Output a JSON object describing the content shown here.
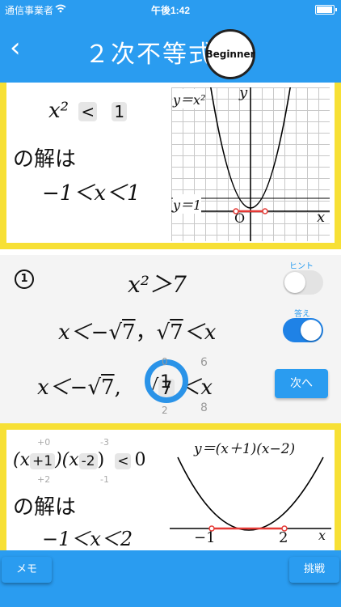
{
  "status_bar": {
    "carrier": "通信事業者",
    "time": "午後1:42"
  },
  "header": {
    "back_icon": "chevron-left-icon",
    "title": "２次不等式",
    "level_badge": "Beginner"
  },
  "example1": {
    "lhs": "x²",
    "op": "<",
    "rhs": "1",
    "solution_label": "の解は",
    "solution": "−1＜x＜1",
    "graph_curve_label": "y＝x²",
    "graph_line_label": "y＝1",
    "axis_y": "y",
    "axis_x": "x",
    "origin": "O"
  },
  "problem": {
    "number": "1",
    "inequality": "x²＞7",
    "hint_label": "ヒント",
    "hint_on": false,
    "answer_label": "答え",
    "answer_on": true,
    "answer_left": "x＜−",
    "answer_root": "7",
    "answer_sep": "，",
    "answer_root2": "7",
    "answer_right": "＜x",
    "input_left": "x＜−",
    "input_root": "7",
    "input_sep": ",",
    "input_coef": "1",
    "input_coef_above": "0",
    "input_coef_below": "2",
    "input_radicand": "7",
    "input_rad_above": "6",
    "input_rad_below": "8",
    "input_right": "＜x",
    "next_label": "次へ",
    "accent": "#2a9cf0"
  },
  "example2": {
    "factor1_open": "(x",
    "factor1_val": "+1",
    "factor1_above": "+0",
    "factor1_below": "+2",
    "factor2_open": ")(x",
    "factor2_val": "-2",
    "factor2_above": "-3",
    "factor2_below": "-1",
    "close": ")",
    "op": "<",
    "rhs": "0",
    "solution_label": "の解は",
    "solution": "−1＜x＜2",
    "graph_label": "y＝(x＋1)(x−2)",
    "root1": "−1",
    "root2": "2",
    "axis_x": "x"
  },
  "footer": {
    "memo_label": "メモ",
    "challenge_label": "挑戦"
  }
}
